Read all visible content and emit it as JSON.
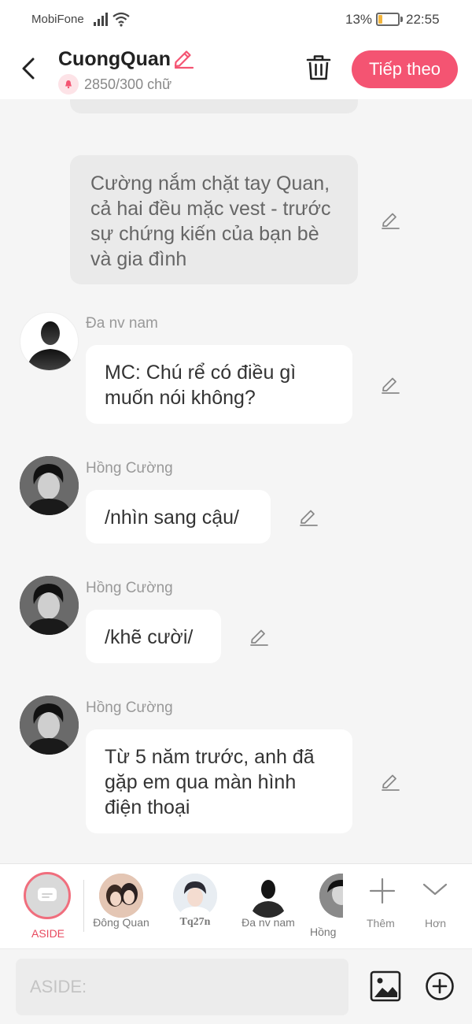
{
  "status_bar": {
    "carrier": "MobiFone",
    "battery_percent": "13%",
    "battery_level": 0.13,
    "time": "22:55"
  },
  "header": {
    "title": "CuongQuan",
    "word_count": "2850/300 chữ",
    "next_label": "Tiếp theo",
    "accent_color": "#f45472"
  },
  "messages": [
    {
      "type": "narration",
      "text": "Cường nắm chặt tay Quan, cả hai đều mặc vest - trước sự chứng kiến của bạn bè và gia đình"
    },
    {
      "type": "character",
      "name": "Đa nv nam",
      "avatar": "silhouette-avatar",
      "text": "MC: Chú rể có điều gì muốn nói không?"
    },
    {
      "type": "character",
      "name": "Hồng Cường",
      "avatar": "photo-avatar",
      "text": "/nhìn sang cậu/"
    },
    {
      "type": "character",
      "name": "Hồng Cường",
      "avatar": "photo-avatar",
      "text": "/khẽ cười/"
    },
    {
      "type": "character",
      "name": "Hồng Cường",
      "avatar": "photo-avatar",
      "text": "Từ 5 năm trước, anh đã gặp em qua màn hình điện thoại"
    }
  ],
  "characters": {
    "aside_label": "ASIDE",
    "items": [
      {
        "name": "Đông Quan"
      },
      {
        "name": "Tq27n"
      },
      {
        "name": "Đa nv nam"
      },
      {
        "name": "Hồng"
      }
    ],
    "add_label": "Thêm",
    "more_label": "Hơn"
  },
  "input": {
    "placeholder": "ASIDE:"
  }
}
